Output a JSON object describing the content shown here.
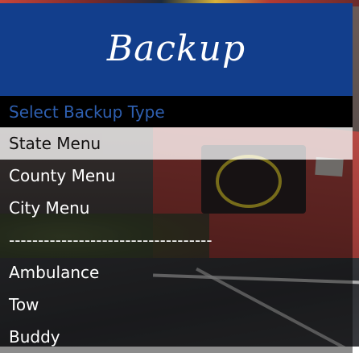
{
  "menu": {
    "title": "Backup",
    "subtitle": "Select Backup Type",
    "items": [
      {
        "label": "State Menu",
        "selected": true
      },
      {
        "label": "County Menu",
        "selected": false
      },
      {
        "label": "City Menu",
        "selected": false
      },
      {
        "label": "-----------------------------------",
        "selected": false
      },
      {
        "label": "Ambulance",
        "selected": false
      },
      {
        "label": "Tow",
        "selected": false
      },
      {
        "label": "Buddy",
        "selected": false
      }
    ]
  },
  "colors": {
    "banner": "#123e8c",
    "subtitle_text": "#2e5fb0",
    "selected_bg": "#f0f0f0"
  }
}
